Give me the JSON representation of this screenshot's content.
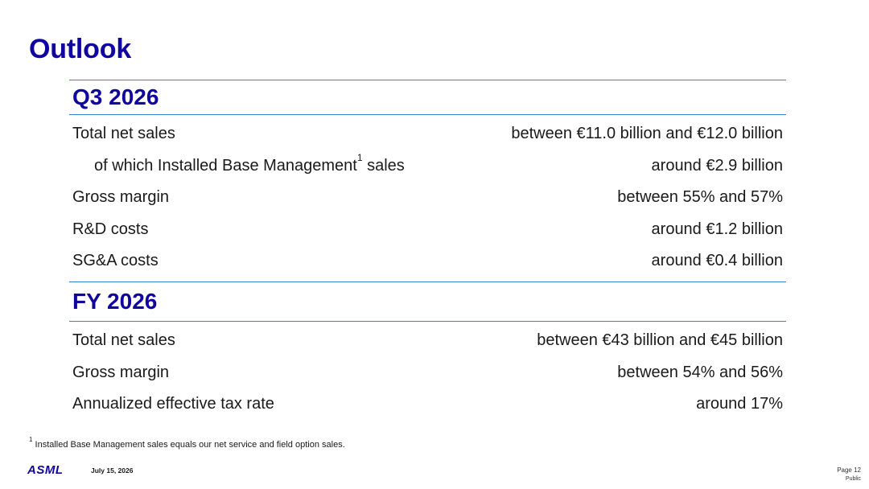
{
  "title": "Outlook",
  "sections": [
    {
      "heading": "Q3 2026",
      "rows": [
        {
          "label": "Total net sales",
          "value": "between €11.0 billion and €12.0 billion"
        },
        {
          "label_prefix": "of which Installed Base Management",
          "footnote_ref": "1",
          "label_suffix": " sales",
          "value": "around €2.9 billion"
        },
        {
          "label": "Gross margin",
          "value": "between 55% and 57%"
        },
        {
          "label": "R&D costs",
          "value": "around €1.2 billion"
        },
        {
          "label": "SG&A costs",
          "value": "around €0.4 billion"
        }
      ]
    },
    {
      "heading": "FY 2026",
      "rows": [
        {
          "label": "Total net sales",
          "value": "between €43 billion and €45 billion"
        },
        {
          "label": "Gross margin",
          "value": "between 54% and 56%"
        },
        {
          "label": "Annualized effective tax rate",
          "value": "around 17%"
        }
      ]
    }
  ],
  "footnote": {
    "marker": "1",
    "text": "Installed Base Management sales equals our net service and field option sales."
  },
  "footer": {
    "logo": "ASML",
    "date": "July 15, 2026",
    "page": "Page 12",
    "classification": "Public"
  },
  "colors": {
    "brand_blue": "#10069f",
    "rule_blue": "#3d7fd6",
    "text": "#1a1a1a"
  }
}
